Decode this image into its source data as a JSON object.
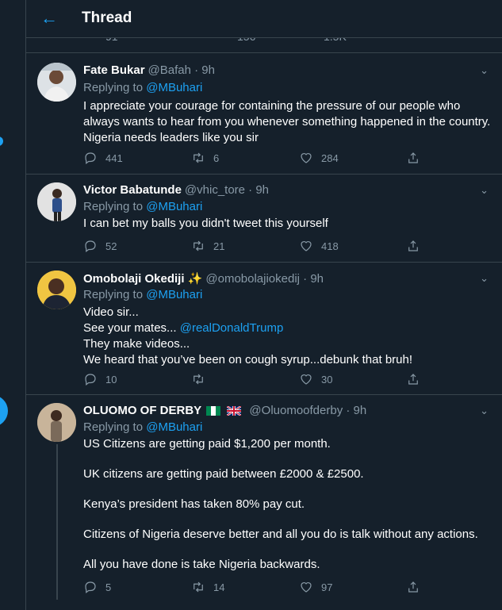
{
  "header": {
    "back_icon": "←",
    "title": "Thread"
  },
  "peek": {
    "replies": "91",
    "retweets": "156",
    "likes": "1.5K"
  },
  "tweets": [
    {
      "name": "Fate Bukar",
      "handle": "@Bafah · 9h",
      "replying_prefix": "Replying to ",
      "replying_to": "@MBuhari",
      "lines": [
        "I appreciate your courage for containing the pressure of our people who",
        "always wants to hear from you whenever something happened in the country.",
        "Nigeria needs leaders like you sir"
      ],
      "replies": "441",
      "retweets": "6",
      "likes": "284"
    },
    {
      "name": "Victor Babatunde",
      "handle": "@vhic_tore · 9h",
      "replying_prefix": "Replying to ",
      "replying_to": "@MBuhari",
      "lines": [
        "I can bet my balls you didn't tweet this yourself"
      ],
      "replies": "52",
      "retweets": "21",
      "likes": "418"
    },
    {
      "name": "Omobolaji Okediji ✨",
      "handle": "@omobolajiokedij · 9h",
      "replying_prefix": "Replying to ",
      "replying_to": "@MBuhari",
      "lines": [
        "Video sir...",
        "See your mates...",
        "They make videos...",
        "We heard that you’ve been on cough syrup...debunk that bruh!"
      ],
      "mention": "@realDonaldTrump",
      "replies": "10",
      "retweets": "",
      "likes": "30"
    },
    {
      "name": "OLUOMO OF DERBY",
      "handle": "@Oluomoofderby · 9h",
      "replying_prefix": "Replying to ",
      "replying_to": "@MBuhari",
      "lines": [
        "US Citizens are getting paid $1,200 per month.",
        "UK citizens are getting paid between £2000 & £2500.",
        "Kenya’s president has taken 80% pay cut.",
        "Citizens of Nigeria deserve better and all you do is talk without any actions.",
        "All you have done is take Nigeria backwards."
      ],
      "replies": "5",
      "retweets": "14",
      "likes": "97"
    }
  ],
  "colors": {
    "background": "#15202b",
    "accent": "#1da1f2",
    "muted": "#8899a6",
    "border": "#38444d"
  }
}
